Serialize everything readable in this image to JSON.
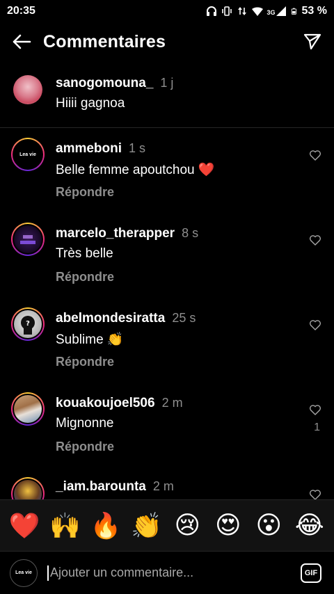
{
  "status": {
    "time": "20:35",
    "network": "3G",
    "battery": "53 %",
    "icons": [
      "headphones-icon",
      "vibrate-icon",
      "data-arrows-icon",
      "wifi-icon",
      "signal-icon",
      "battery-icon"
    ]
  },
  "header": {
    "title": "Commentaires",
    "back_icon": "arrow-left-icon",
    "share_icon": "paper-plane-icon"
  },
  "caption": {
    "username": "sanogomouna_",
    "time": "1 j",
    "text": "Hiiii gagnoa"
  },
  "comments": [
    {
      "username": "ammeboni",
      "time": "1 s",
      "text": "Belle femme apoutchou ❤️",
      "reply": "Répondre",
      "likes": "",
      "avatar_text": "Lea vie"
    },
    {
      "username": "marcelo_therapper",
      "time": "8 s",
      "text": "Très belle",
      "reply": "Répondre",
      "likes": "",
      "avatar_text": ""
    },
    {
      "username": "abelmondesiratta",
      "time": "25 s",
      "text": "Sublime 👏",
      "reply": "Répondre",
      "likes": "",
      "avatar_text": "?"
    },
    {
      "username": "kouakoujoel506",
      "time": "2 m",
      "text": "Mignonne",
      "reply": "Répondre",
      "likes": "1",
      "avatar_text": ""
    },
    {
      "username": "_iam.barounta",
      "time": "2 m",
      "text": "",
      "reply": "",
      "likes": "",
      "avatar_text": ""
    }
  ],
  "emoji_bar": [
    "❤️",
    "🙌",
    "🔥",
    "👏",
    "😢",
    "😍",
    "😮",
    "😂"
  ],
  "input": {
    "placeholder": "Ajouter un commentaire...",
    "gif_label": "GIF",
    "avatar_text": "Lea vie"
  },
  "colors": {
    "background": "#000000",
    "secondary_text": "#8e8e8e",
    "divider": "#262626",
    "heart_red": "#ed4956"
  }
}
